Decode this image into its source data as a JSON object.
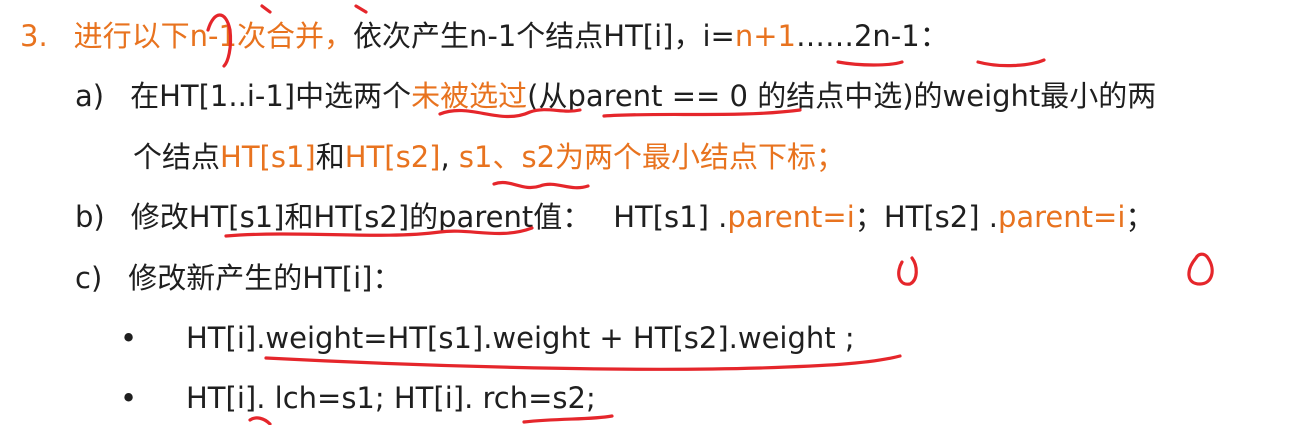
{
  "step3": {
    "number": "3.",
    "orange_text": "进行以下n-1次合并，",
    "rest_text": "依次产生n-1个结点HT[i]，i=",
    "range_start": "n+1",
    "range_end": "……2n-1："
  },
  "step_a": {
    "label": "a)",
    "part1": "在HT[1..i-1]中选两个",
    "highlight": "未被选过",
    "part2": "(从parent == 0 的结点中选)的weight最小的两",
    "cont_prefix": "个结点",
    "node_s1": "HT[s1]",
    "and": "和",
    "node_s2": "HT[s2]",
    "comma": ", ",
    "cont_highlight": "s1、s2为两个最小结点下标；"
  },
  "step_b": {
    "label": "b)",
    "text": "修改HT[s1]和HT[s2]的parent值：",
    "assign1_prefix": "HT[s1] .",
    "assign1_value": "parent=i",
    "sep": "；",
    "assign2_prefix": "HT[s2] .",
    "assign2_value": "parent=i",
    "end": "；"
  },
  "step_c": {
    "label": "c)",
    "text": "修改新产生的HT[i]："
  },
  "bullets": [
    {
      "symbol": "•",
      "text": "HT[i].weight=HT[s1].weight + HT[s2].weight ;"
    },
    {
      "symbol": "•",
      "text": "HT[i]. lch=s1; HT[i]. rch=s2;"
    }
  ]
}
